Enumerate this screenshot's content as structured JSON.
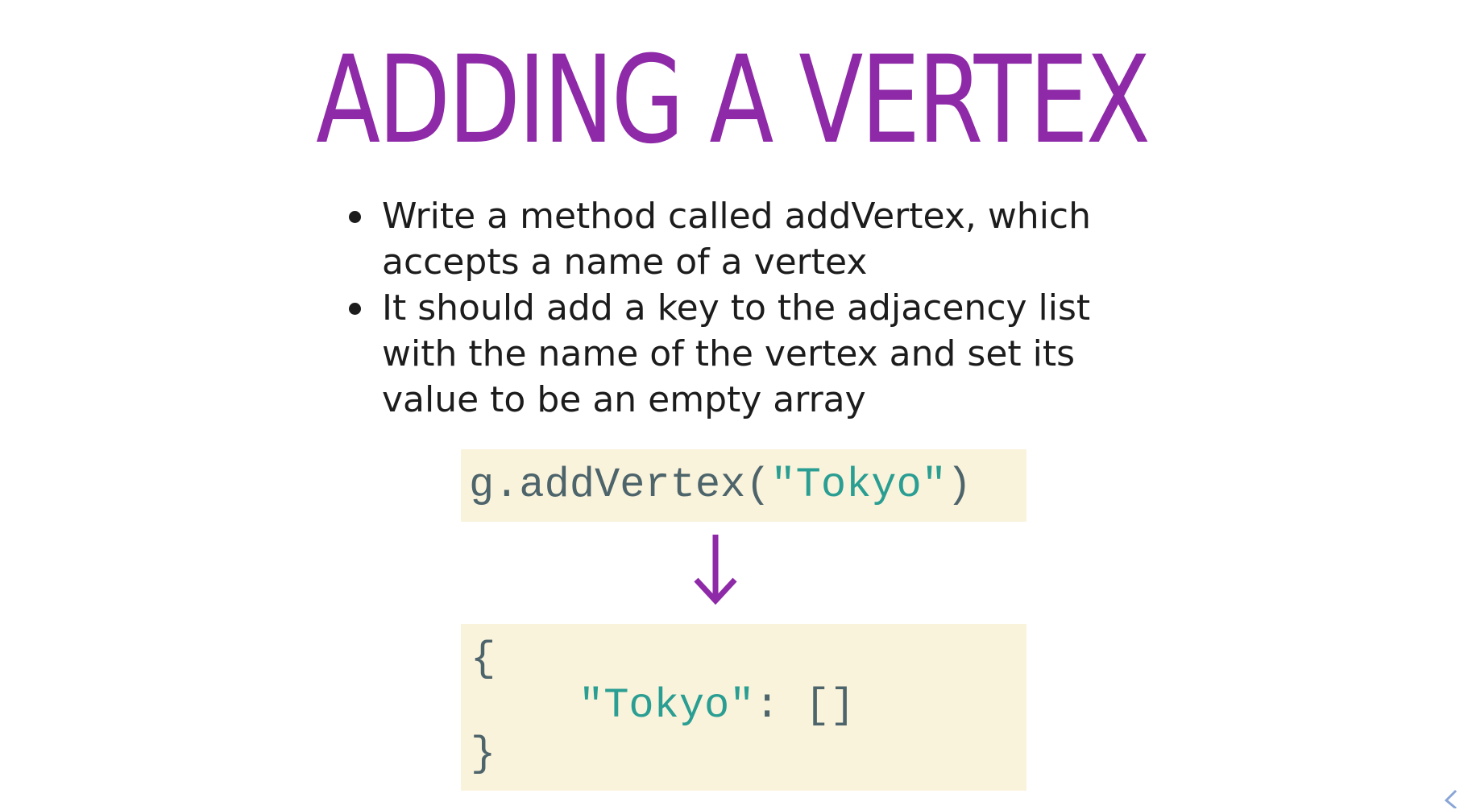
{
  "slide": {
    "title": "ADDING A VERTEX",
    "bullets": [
      "Write a method called addVertex, which accepts a name of a vertex",
      "It should add a key to the adjacency list with the name of the vertex and set its value to be an empty array"
    ],
    "code_call": {
      "prefix": "g.addVertex(",
      "argument": "\"Tokyo\"",
      "suffix": ")"
    },
    "code_result": {
      "open_brace": "{",
      "key": "\"Tokyo\"",
      "separator": ": ",
      "value": "[]",
      "close_brace": "}"
    },
    "arrow_icon": "down-arrow-icon",
    "nav_icon": "chevron-left-icon"
  },
  "colors": {
    "title": "#8e2aa8",
    "arrow": "#8e2aa8",
    "code_background": "#faf3dc",
    "code_text": "#4d646b",
    "code_string": "#2a9e92",
    "nav_chevron": "#8aa6d6"
  }
}
